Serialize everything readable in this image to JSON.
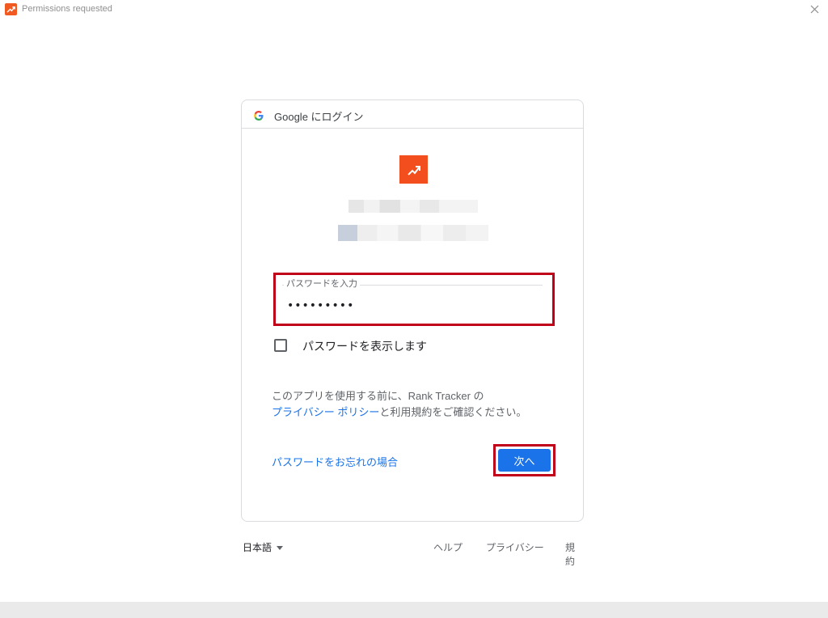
{
  "window": {
    "title": "Permissions requested"
  },
  "card": {
    "header": "Google にログイン"
  },
  "password": {
    "label": "パスワードを入力",
    "value": "•••••••••"
  },
  "show_password": {
    "label": "パスワードを表示します",
    "checked": false
  },
  "notice": {
    "line1": "このアプリを使用する前に、Rank Tracker の",
    "privacy_link": "プライバシー ポリシー",
    "line2_rest": "と利用規約をご確認ください。"
  },
  "forgot_link": "パスワードをお忘れの場合",
  "next_button": "次へ",
  "footer": {
    "language": "日本語",
    "help": "ヘルプ",
    "privacy": "プライバシー",
    "terms": "規約"
  },
  "colors": {
    "accent": "#1a73e8",
    "brand": "#f24e1e",
    "highlight": "#c00018"
  }
}
